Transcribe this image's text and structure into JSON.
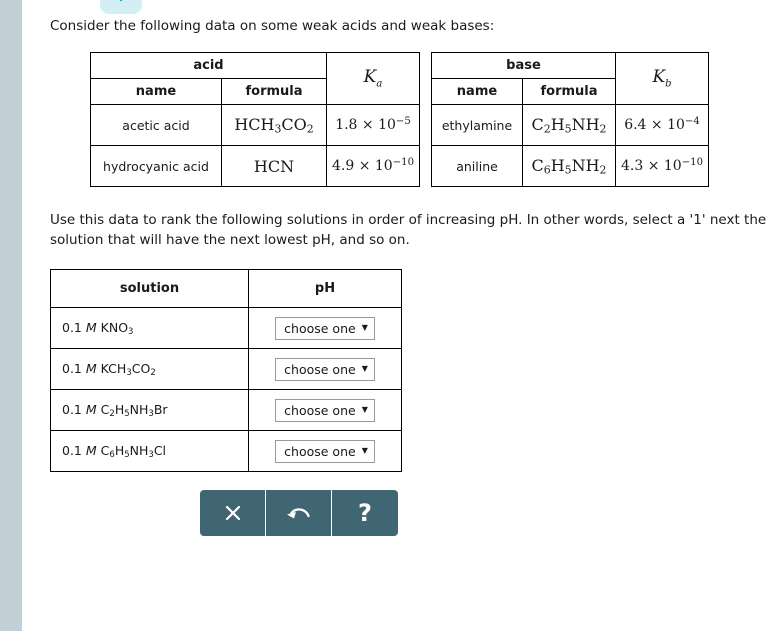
{
  "chevron": {
    "icon": "chevron-down-icon",
    "fill": "#16a8c4",
    "pill_bg": "#d4eef5"
  },
  "intro": {
    "text": "Consider the following data on some weak acids and weak bases:"
  },
  "acid_table": {
    "group_header": "acid",
    "columns": [
      "name",
      "formula"
    ],
    "k_header": "K",
    "k_sub": "a",
    "rows": [
      {
        "name": "acetic acid",
        "formula_html": "HCH<sub>3</sub>CO<sub>2</sub>",
        "k_mantissa": "1.8 × 10",
        "k_exp": "−5"
      },
      {
        "name": "hydrocyanic acid",
        "formula_html": "HCN",
        "k_mantissa": "4.9 × 10",
        "k_exp": "−10"
      }
    ]
  },
  "base_table": {
    "group_header": "base",
    "columns": [
      "name",
      "formula"
    ],
    "k_header": "K",
    "k_sub": "b",
    "rows": [
      {
        "name": "ethylamine",
        "formula_html": "C<sub>2</sub>H<sub>5</sub>NH<sub>2</sub>",
        "k_mantissa": "6.4 × 10",
        "k_exp": "−4"
      },
      {
        "name": "aniline",
        "formula_html": "C<sub>6</sub>H<sub>5</sub>NH<sub>2</sub>",
        "k_mantissa": "4.3 × 10",
        "k_exp": "−10"
      }
    ]
  },
  "instruction": {
    "text": "Use this data to rank the following solutions in order of increasing pH. In other words, select a '1' next the solution that will have the next lowest pH, and so on."
  },
  "solution_table": {
    "headers": {
      "solution": "solution",
      "ph": "pH"
    },
    "rows": [
      {
        "concentration": "0.1",
        "molarity": "M",
        "formula_html": "KNO<sub>3</sub>",
        "ph_value": "choose one",
        "caret": "▼"
      },
      {
        "concentration": "0.1",
        "molarity": "M",
        "formula_html": "KCH<sub>3</sub>CO<sub>2</sub>",
        "ph_value": "choose one",
        "caret": "▼"
      },
      {
        "concentration": "0.1",
        "molarity": "M",
        "formula_html": "C<sub>2</sub>H<sub>5</sub>NH<sub>3</sub>Br",
        "ph_value": "choose one",
        "caret": "▼"
      },
      {
        "concentration": "0.1",
        "molarity": "M",
        "formula_html": "C<sub>6</sub>H<sub>5</sub>NH<sub>3</sub>Cl",
        "ph_value": "choose one",
        "caret": "▼"
      }
    ]
  },
  "buttons": {
    "bar_color": "#416673",
    "items": [
      {
        "name": "clear-button",
        "icon": "close-icon",
        "label": "×"
      },
      {
        "name": "undo-button",
        "icon": "undo-arrow-icon",
        "label": ""
      },
      {
        "name": "help-button",
        "icon": "question-mark-icon",
        "label": "?"
      }
    ]
  },
  "colors": {
    "gutter": "#c3cfd6",
    "page_bg": "#ffffff",
    "border": "#000000"
  }
}
